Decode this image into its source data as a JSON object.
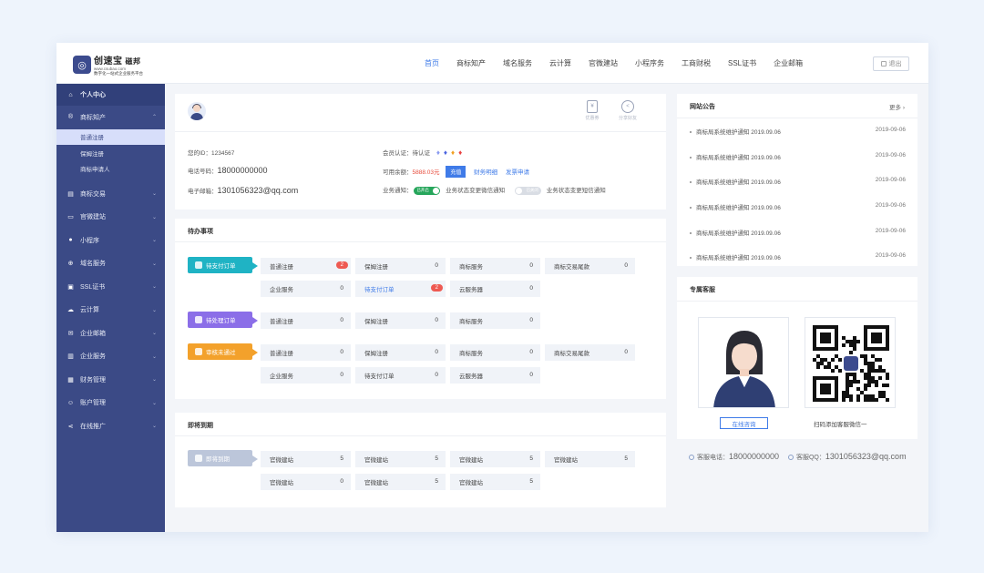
{
  "brand": {
    "name": "创速宝",
    "stamp": "磁邦",
    "url": "www.csubao.com",
    "slogan": "数字化一站式企业服务平台"
  },
  "nav": {
    "items": [
      "首页",
      "商标知产",
      "域名服务",
      "云计算",
      "官微建站",
      "小程序务",
      "工商财税",
      "SSL证书",
      "企业邮箱"
    ],
    "active_index": 0,
    "logout": "退出"
  },
  "sidebar": {
    "personal_center": "个人中心",
    "trademark": "商标知产",
    "trademark_sub": [
      "普通注册",
      "保姆注册",
      "商标申请人"
    ],
    "items": [
      "商标交易",
      "官微建站",
      "小程序",
      "域名服务",
      "SSL证书",
      "云计算",
      "企业邮箱",
      "企业服务",
      "财务管理",
      "账户管理",
      "在线推广"
    ]
  },
  "profile": {
    "icon_invoice": "优惠券",
    "icon_share": "分享好友",
    "id_label": "您的ID：",
    "id_value": "1234567",
    "phone_label": "电话号码：",
    "phone_value": "18000000000",
    "email_label": "电子邮箱：",
    "email_value": "1301056323@qq.com",
    "member_label": "会员认证：",
    "member_value": "待认证",
    "balance_label": "可用余额：",
    "balance_value": "5888.03元",
    "recharge": "充值",
    "finance_detail": "财务明细",
    "invoice_apply": "发票申请",
    "notify_label": "业务通知：",
    "toggle_on_text": "已开启",
    "toggle_off_text": "已关闭",
    "wechat_notify": "业务状态变更微信通知",
    "sms_notify": "业务状态变更短信通知",
    "diamond_colors": [
      "#8a9bf0",
      "#4a63e0",
      "#f0a020",
      "#e84040"
    ]
  },
  "todo": {
    "title": "待办事项",
    "groups": [
      {
        "tag": "待支付订单",
        "rows": [
          [
            {
              "name": "普通注册",
              "count": "2",
              "badge": true
            },
            {
              "name": "保姆注册",
              "count": "0"
            },
            {
              "name": "商标服务",
              "count": "0"
            },
            {
              "name": "商标交易尾款",
              "count": "0"
            }
          ],
          [
            {
              "name": "企业服务",
              "count": "0"
            },
            {
              "name": "待支付订单",
              "count": "2",
              "badge": true,
              "highlight": true
            },
            {
              "name": "云服务器",
              "count": "0"
            }
          ]
        ]
      },
      {
        "tag": "待处理订单",
        "rows": [
          [
            {
              "name": "普通注册",
              "count": "0"
            },
            {
              "name": "保姆注册",
              "count": "0"
            },
            {
              "name": "商标服务",
              "count": "0"
            }
          ]
        ]
      },
      {
        "tag": "审核未通过",
        "rows": [
          [
            {
              "name": "普通注册",
              "count": "0"
            },
            {
              "name": "保姆注册",
              "count": "0"
            },
            {
              "name": "商标服务",
              "count": "0"
            },
            {
              "name": "商标交易尾款",
              "count": "0"
            }
          ],
          [
            {
              "name": "企业服务",
              "count": "0"
            },
            {
              "name": "待支付订单",
              "count": "0"
            },
            {
              "name": "云服务器",
              "count": "0"
            }
          ]
        ]
      }
    ]
  },
  "expiry": {
    "title": "即将到期",
    "tag": "即将到期",
    "rows": [
      [
        {
          "name": "官微建站",
          "count": "5"
        },
        {
          "name": "官微建站",
          "count": "5"
        },
        {
          "name": "官微建站",
          "count": "5"
        },
        {
          "name": "官微建站",
          "count": "5"
        }
      ],
      [
        {
          "name": "官微建站",
          "count": "0"
        },
        {
          "name": "官微建站",
          "count": "5"
        },
        {
          "name": "官微建站",
          "count": "5"
        }
      ]
    ]
  },
  "notice": {
    "title": "网站公告",
    "more": "更多",
    "items": [
      {
        "text": "商标局系统维护通知 2019.09.06",
        "date": "2019-09-06"
      },
      {
        "text": "商标局系统维护通知 2019.09.06",
        "date": "2019-09-06"
      },
      {
        "text": "商标局系统维护通知 2019.09.06",
        "date": "2019-09-06"
      },
      {
        "text": "商标局系统维护通知 2019.09.06",
        "date": "2019-09-06"
      },
      {
        "text": "商标局系统维护通知 2019.09.06",
        "date": "2019-09-06"
      },
      {
        "text": "商标局系统维护通知 2019.09.06",
        "date": "2019-09-06"
      }
    ]
  },
  "service": {
    "title": "专属客服",
    "online": "在线咨询",
    "scan_tip": "扫码添加客服微信一",
    "phone_label": "客服电话：",
    "phone_value": "18000000000",
    "qq_label": "客服QQ：",
    "qq_value": "1301056323@qq.com"
  }
}
